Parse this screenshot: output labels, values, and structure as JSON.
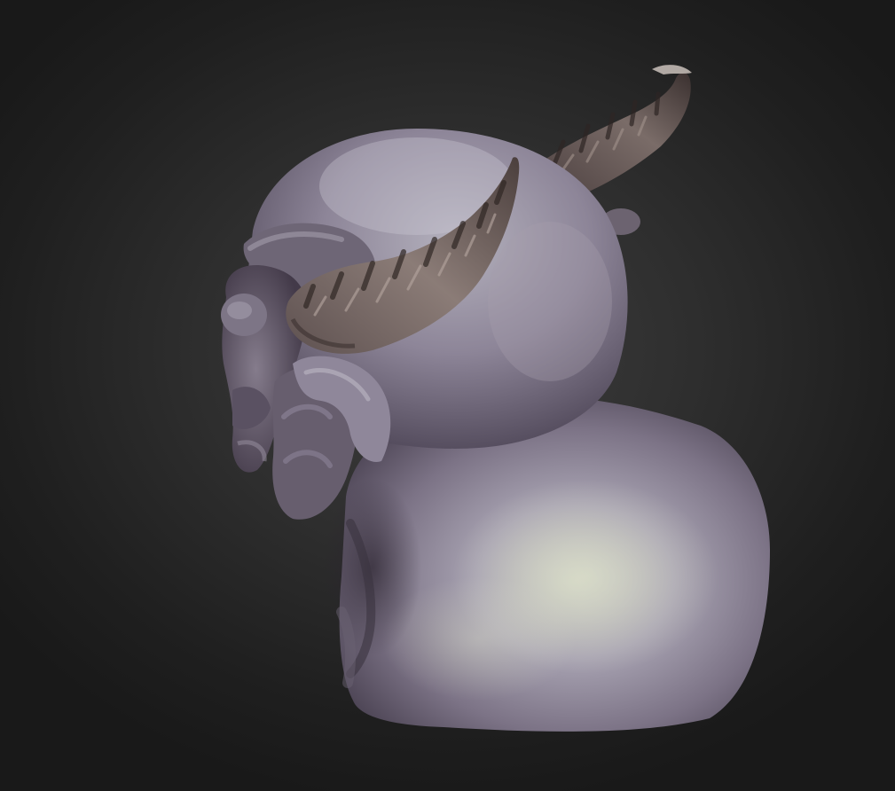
{
  "scene": {
    "subject": "sculpt-bust",
    "colors": {
      "background_center": "#3e3e3e",
      "background_edge": "#191919",
      "skin_light": "#c7c4d2",
      "skin_mid": "#8e8798",
      "skin_dark": "#4c4454",
      "skin_highlight": "#d8dcc4",
      "horn_light": "#8a7a74",
      "horn_dark": "#3d3230"
    }
  }
}
